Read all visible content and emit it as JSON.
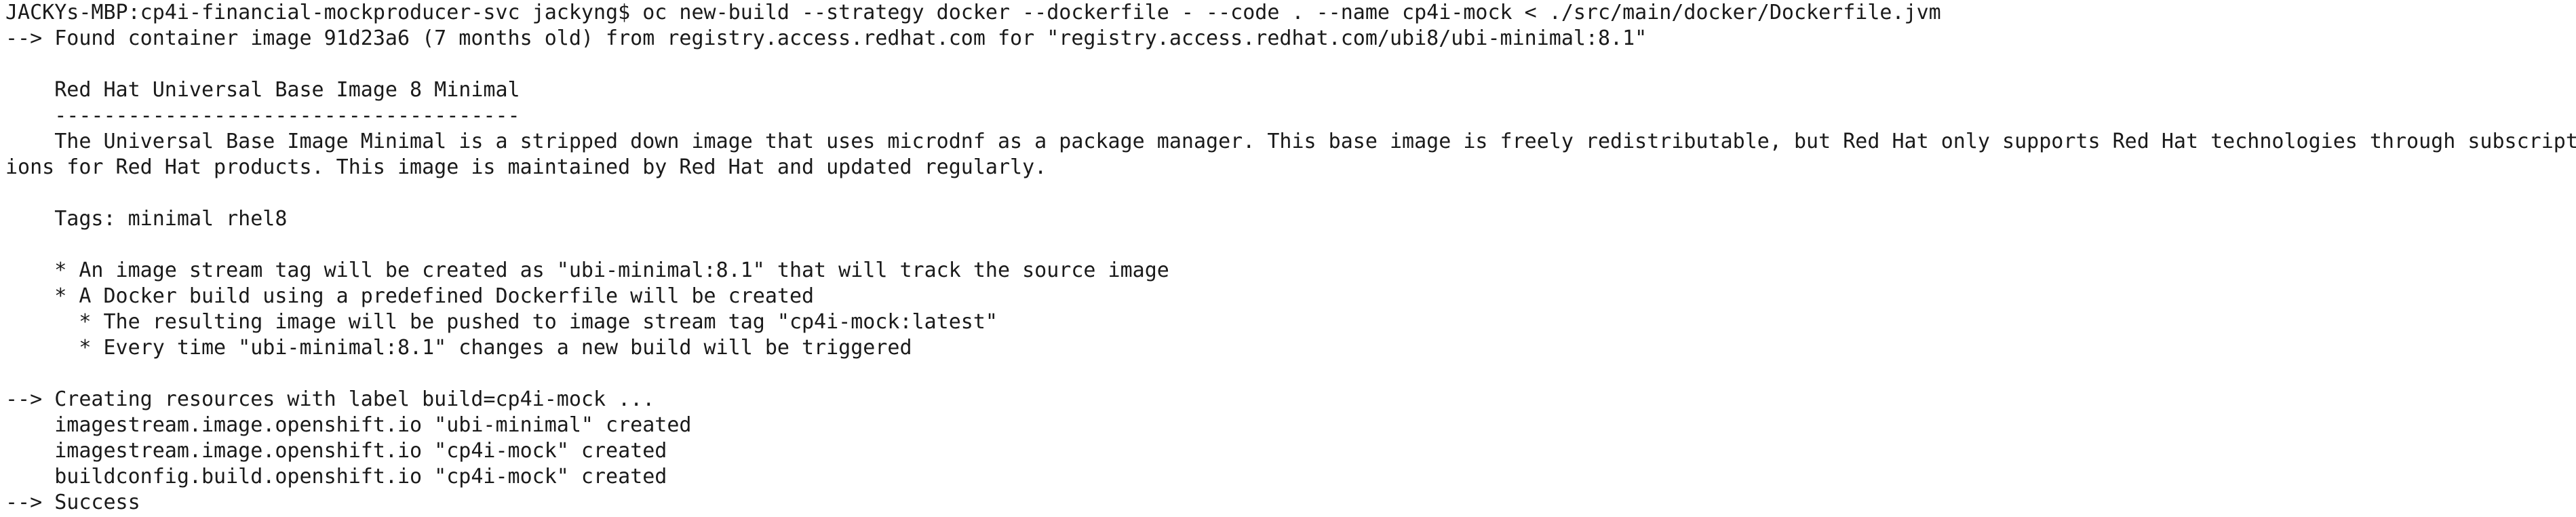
{
  "terminal": {
    "lines": [
      "JACKYs-MBP:cp4i-financial-mockproducer-svc jackyng$ oc new-build --strategy docker --dockerfile - --code . --name cp4i-mock < ./src/main/docker/Dockerfile.jvm",
      "--> Found container image 91d23a6 (7 months old) from registry.access.redhat.com for \"registry.access.redhat.com/ubi8/ubi-minimal:8.1\"",
      "",
      "    Red Hat Universal Base Image 8 Minimal",
      "    --------------------------------------",
      "    The Universal Base Image Minimal is a stripped down image that uses microdnf as a package manager. This base image is freely redistributable, but Red Hat only supports Red Hat technologies through subscript",
      "ions for Red Hat products. This image is maintained by Red Hat and updated regularly.",
      "",
      "    Tags: minimal rhel8",
      "",
      "    * An image stream tag will be created as \"ubi-minimal:8.1\" that will track the source image",
      "    * A Docker build using a predefined Dockerfile will be created",
      "      * The resulting image will be pushed to image stream tag \"cp4i-mock:latest\"",
      "      * Every time \"ubi-minimal:8.1\" changes a new build will be triggered",
      "",
      "--> Creating resources with label build=cp4i-mock ...",
      "    imagestream.image.openshift.io \"ubi-minimal\" created",
      "    imagestream.image.openshift.io \"cp4i-mock\" created",
      "    buildconfig.build.openshift.io \"cp4i-mock\" created",
      "--> Success"
    ]
  }
}
